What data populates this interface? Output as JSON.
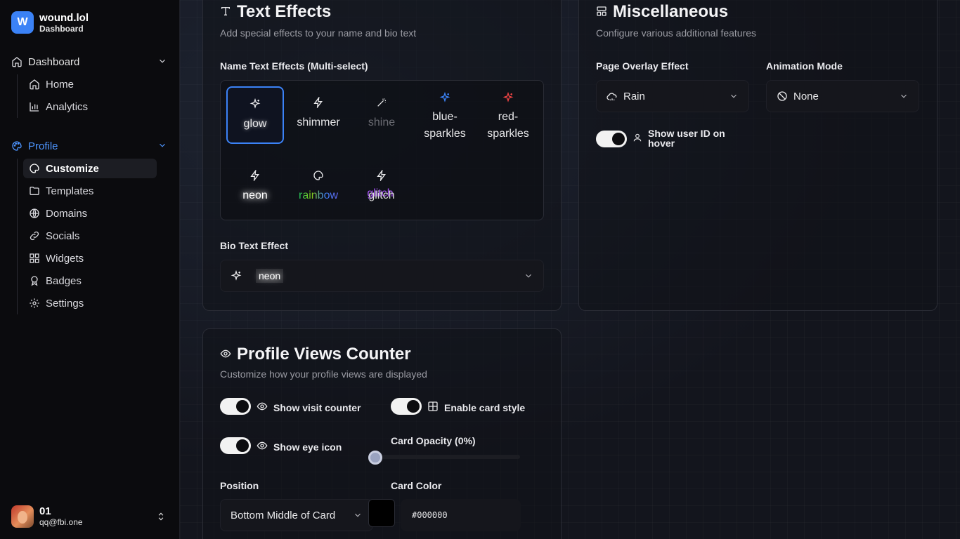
{
  "brand": {
    "logo_letter": "W",
    "name": "wound.lol",
    "subtitle": "Dashboard"
  },
  "nav": {
    "dashboard": {
      "label": "Dashboard",
      "items": [
        {
          "label": "Home",
          "icon": "home-icon"
        },
        {
          "label": "Analytics",
          "icon": "bar-chart-icon"
        }
      ]
    },
    "profile": {
      "label": "Profile",
      "items": [
        {
          "label": "Customize",
          "icon": "palette-icon",
          "active": true
        },
        {
          "label": "Templates",
          "icon": "folder-icon"
        },
        {
          "label": "Domains",
          "icon": "globe-icon"
        },
        {
          "label": "Socials",
          "icon": "link-icon"
        },
        {
          "label": "Widgets",
          "icon": "grid-icon"
        },
        {
          "label": "Badges",
          "icon": "award-icon"
        },
        {
          "label": "Settings",
          "icon": "gear-icon"
        }
      ]
    }
  },
  "user": {
    "name": "01",
    "email": "qq@fbi.one"
  },
  "text_effects": {
    "title": "Text Effects",
    "subtitle": "Add special effects to your name and bio text",
    "name_label": "Name Text Effects (Multi-select)",
    "effects": [
      {
        "label": "glow",
        "icon": "sparkles-icon",
        "selected": true
      },
      {
        "label": "shimmer",
        "icon": "zap-icon"
      },
      {
        "label": "shine",
        "icon": "wand-icon"
      },
      {
        "label": "blue-\nsparkles",
        "icon": "sparkles-icon",
        "color": "#3b82f6"
      },
      {
        "label": "red-\nsparkles",
        "icon": "sparkles-icon",
        "color": "#ef4444"
      },
      {
        "label": "neon",
        "icon": "zap-icon"
      },
      {
        "label": "rainbow",
        "icon": "palette-icon"
      },
      {
        "label": "glitch",
        "icon": "zap-icon"
      }
    ],
    "bio_label": "Bio Text Effect",
    "bio_value": "neon"
  },
  "misc": {
    "title": "Miscellaneous",
    "subtitle": "Configure various additional features",
    "overlay_label": "Page Overlay Effect",
    "overlay_value": "Rain",
    "animation_label": "Animation Mode",
    "animation_value": "None",
    "user_id_toggle_label": "Show user ID on hover"
  },
  "views_counter": {
    "title": "Profile Views Counter",
    "subtitle": "Customize how your profile views are displayed",
    "show_visit_counter": "Show visit counter",
    "enable_card_style": "Enable card style",
    "show_eye_icon": "Show eye icon",
    "card_opacity_label": "Card Opacity (0%)",
    "card_opacity": 0,
    "position_label": "Position",
    "position_value": "Bottom Middle of Card",
    "card_color_label": "Card Color",
    "card_color": "#000000"
  },
  "colors": {
    "accent": "#3b82f6",
    "active_nav": "#4d95ff"
  }
}
